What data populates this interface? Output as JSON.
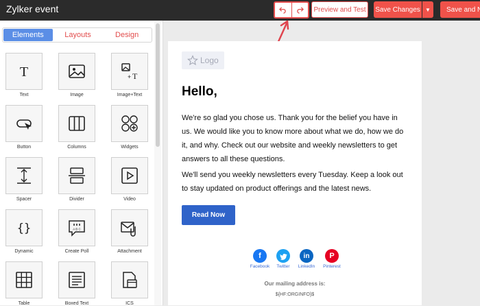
{
  "header": {
    "title": "Zylker event",
    "preview_label": "Preview and Test",
    "save_label": "Save Changes",
    "save_next_label": "Save and Next"
  },
  "sidebar": {
    "tabs": [
      "Elements",
      "Layouts",
      "Design"
    ],
    "elements": [
      "Text",
      "Image",
      "Image+Text",
      "Button",
      "Columns",
      "Widgets",
      "Spacer",
      "Divider",
      "Video",
      "Dynamic",
      "Create Poll",
      "Attachment",
      "Table",
      "Boxed Text",
      "ICS"
    ]
  },
  "email": {
    "logo_label": "Logo",
    "heading": "Hello,",
    "paragraph1": "We're so glad you chose us. Thank you for the belief you have in us. We would like you to know more about what we do, how we do it, and why. Check out our website and weekly newsletters to get answers to all these questions.",
    "paragraph2": "We'll send you weekly newsletters every Tuesday. Keep a look out to stay updated on product offerings and the latest news.",
    "button_label": "Read Now",
    "social": [
      "Facebook",
      "Twitter",
      "LinkedIn",
      "Pinterest"
    ],
    "mailing_title": "Our mailing address is:",
    "mailing_value": "${HF:ORGINFO}$"
  },
  "colors": {
    "accent": "#f0524a",
    "topbar": "#2b2b2b",
    "active_tab": "#5b8ee6",
    "primary_button": "#2f63c9",
    "facebook": "#1877f2",
    "twitter": "#1da1f2",
    "linkedin": "#0a66c2",
    "pinterest": "#e60023"
  }
}
